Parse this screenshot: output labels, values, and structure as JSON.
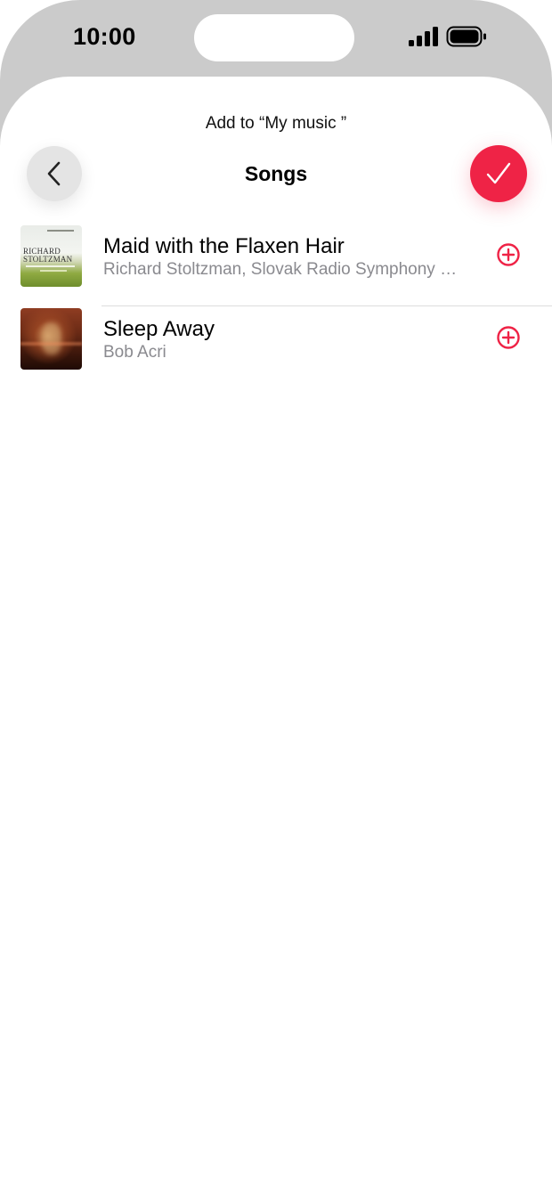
{
  "status_bar": {
    "time": "10:00",
    "icons": [
      "cellular-signal-icon",
      "battery-icon"
    ]
  },
  "sheet": {
    "subtitle": "Add to “My music ”",
    "title": "Songs",
    "back_icon": "chevron-left-icon",
    "done_icon": "checkmark-icon"
  },
  "songs": [
    {
      "title": "Maid with the Flaxen Hair",
      "artist": "Richard Stoltzman, Slovak Radio Symphony Orchestra",
      "artwork_text": "RICHARD STOLTZMAN",
      "add_icon": "plus-circle-icon"
    },
    {
      "title": "Sleep Away",
      "artist": "Bob Acri",
      "add_icon": "plus-circle-icon"
    }
  ],
  "colors": {
    "accent": "#ef2346",
    "secondary_text": "#8a8a8f",
    "status_bar_bg": "#cbcbcb"
  }
}
